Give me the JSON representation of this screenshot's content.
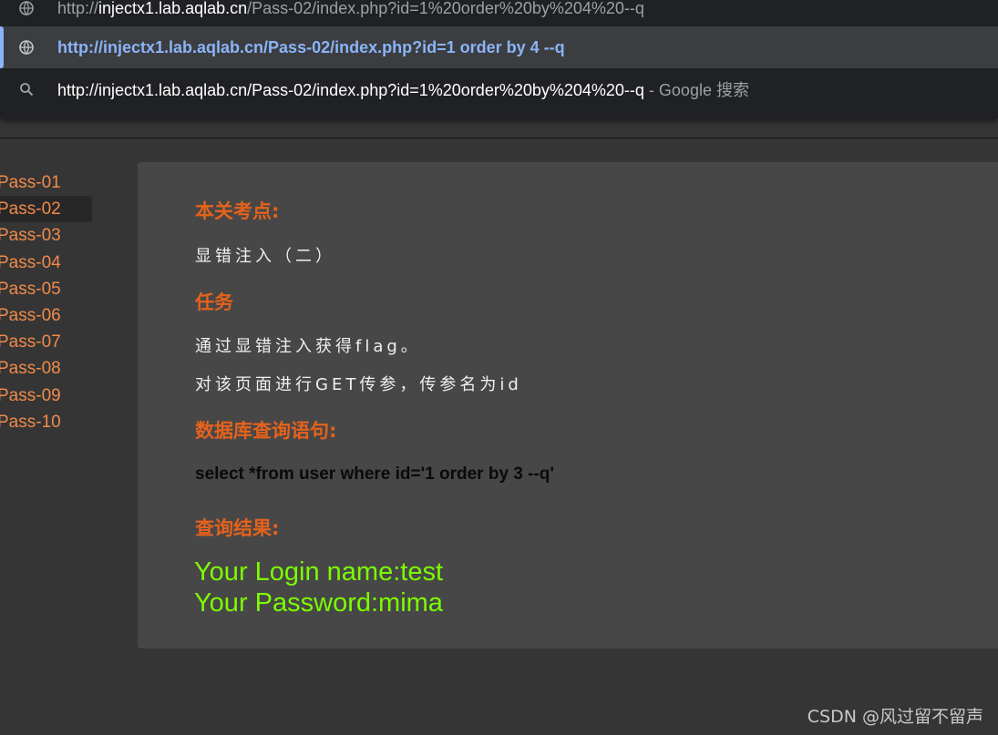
{
  "omnibox": {
    "suggestions": [
      {
        "icon": "globe-icon",
        "host_prefix": "http://",
        "host": "injectx1.lab.aqlab.cn",
        "path": "/Pass-02/index.php?id=1%20order%20by%204%20--q",
        "hint": ""
      },
      {
        "icon": "globe-icon",
        "text": "http://injectx1.lab.aqlab.cn/Pass-02/index.php?id=1 order by 4 --q",
        "selected": true
      },
      {
        "icon": "search-icon",
        "text": "http://injectx1.lab.aqlab.cn/Pass-02/index.php?id=1%20order%20by%204%20--q",
        "hint": " - Google 搜索"
      }
    ]
  },
  "sidebar": {
    "items": [
      {
        "label": "Pass-01"
      },
      {
        "label": "Pass-02"
      },
      {
        "label": "Pass-03"
      },
      {
        "label": "Pass-04"
      },
      {
        "label": "Pass-05"
      },
      {
        "label": "Pass-06"
      },
      {
        "label": "Pass-07"
      },
      {
        "label": "Pass-08"
      },
      {
        "label": "Pass-09"
      },
      {
        "label": "Pass-10"
      }
    ],
    "active_item": "Pass-02"
  },
  "content": {
    "topic_heading": "本关考点:",
    "topic_text": "显错注入（二）",
    "task_heading": "任务",
    "task_line1": "通过显错注入获得flag。",
    "task_line2": "对该页面进行GET传参，传参名为id",
    "query_heading": "数据库查询语句:",
    "query_text": "select *from user where id='1 order by 3 --q'",
    "result_heading": "查询结果:",
    "result_line1": "Your Login name:test",
    "result_line2": "Your Password:mima"
  },
  "colors": {
    "accent_orange": "#e5621c",
    "sidebar_link": "#f08a4b",
    "result_green": "#7cfc00",
    "selected_blue": "#8ab4f8"
  },
  "watermark": "CSDN @风过留不留声"
}
